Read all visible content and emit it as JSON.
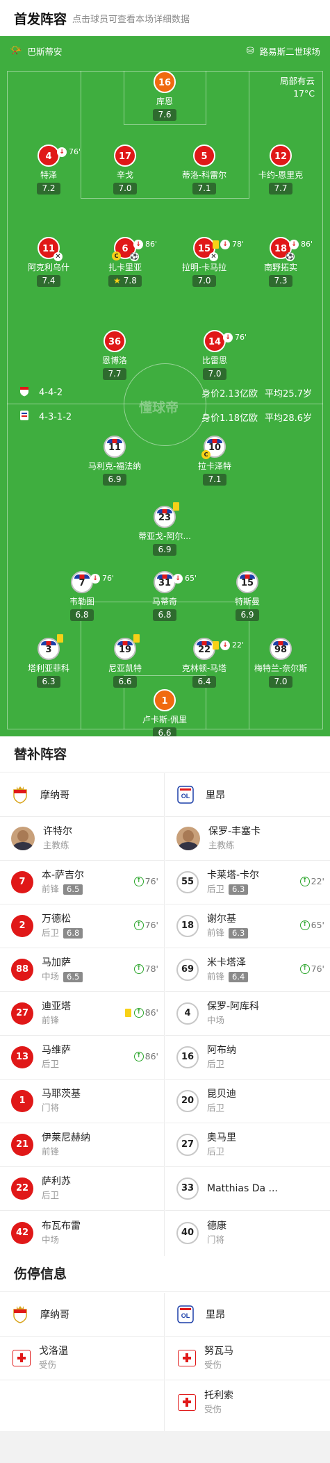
{
  "header": {
    "title": "首发阵容",
    "subtitle": "点击球员可查看本场详细数据"
  },
  "pitch": {
    "home_team": "巴斯蒂安",
    "stadium": "路易斯二世球场",
    "weather": "局部有云",
    "temperature": "17°C",
    "watermark": "懂球帝",
    "home_formation": "4-4-2",
    "home_value": "身价2.13亿欧",
    "home_age": "平均25.7岁",
    "away_formation": "4-3-1-2",
    "away_value": "身价1.18亿欧",
    "away_age": "平均28.6岁"
  },
  "home_players": [
    {
      "num": "16",
      "name": "库恩",
      "score": "7.6"
    },
    {
      "num": "4",
      "name": "特泽",
      "score": "7.2",
      "sub_min": "76'"
    },
    {
      "num": "17",
      "name": "辛戈",
      "score": "7.0"
    },
    {
      "num": "5",
      "name": "蒂洛-科雷尔",
      "score": "7.1"
    },
    {
      "num": "12",
      "name": "卡约-恩里克",
      "score": "7.7"
    },
    {
      "num": "11",
      "name": "阿克利乌什",
      "score": "7.4"
    },
    {
      "num": "6",
      "name": "扎卡里亚",
      "score": "7.8",
      "sub_min": "86'"
    },
    {
      "num": "15",
      "name": "拉明-卡马拉",
      "score": "7.0",
      "sub_min": "78'"
    },
    {
      "num": "18",
      "name": "南野拓实",
      "score": "7.3",
      "sub_min": "86'"
    },
    {
      "num": "36",
      "name": "恩博洛",
      "score": "7.7"
    },
    {
      "num": "14",
      "name": "比雷思",
      "score": "7.0",
      "sub_min": "76'"
    }
  ],
  "away_players": [
    {
      "num": "11",
      "name": "马利克-福法纳",
      "score": "6.9"
    },
    {
      "num": "10",
      "name": "拉卡泽特",
      "score": "7.1"
    },
    {
      "num": "23",
      "name": "蒂亚戈-阿尔...",
      "score": "6.9"
    },
    {
      "num": "7",
      "name": "韦勒图",
      "score": "6.8",
      "sub_min": "76'"
    },
    {
      "num": "31",
      "name": "马蒂奇",
      "score": "6.8",
      "sub_min": "65'"
    },
    {
      "num": "15",
      "name": "特斯曼",
      "score": "6.9"
    },
    {
      "num": "3",
      "name": "塔利亚菲科",
      "score": "6.3"
    },
    {
      "num": "19",
      "name": "尼亚凯特",
      "score": "6.6"
    },
    {
      "num": "22",
      "name": "克林顿-马塔",
      "score": "6.4",
      "sub_min": "22'"
    },
    {
      "num": "98",
      "name": "梅特兰-奈尔斯",
      "score": "7.0"
    },
    {
      "num": "1",
      "name": "卢卡斯-佩里",
      "score": "6.6"
    }
  ],
  "subs": {
    "title": "替补阵容",
    "home_team": "摩纳哥",
    "away_team": "里昂",
    "home_coach": {
      "name": "许特尔",
      "role": "主教练"
    },
    "away_coach": {
      "name": "保罗-丰塞卡",
      "role": "主教练"
    },
    "home": [
      {
        "num": "7",
        "name": "本-萨吉尔",
        "pos": "前锋",
        "score": "6.5",
        "min": "76'"
      },
      {
        "num": "2",
        "name": "万德松",
        "pos": "后卫",
        "score": "6.8",
        "min": "76'"
      },
      {
        "num": "88",
        "name": "马加萨",
        "pos": "中场",
        "score": "6.5",
        "min": "78'"
      },
      {
        "num": "27",
        "name": "迪亚塔",
        "pos": "前锋",
        "min": "86'"
      },
      {
        "num": "13",
        "name": "马维萨",
        "pos": "后卫",
        "min": "86'"
      },
      {
        "num": "1",
        "name": "马耶茨基",
        "pos": "门将"
      },
      {
        "num": "21",
        "name": "伊莱尼赫纳",
        "pos": "前锋"
      },
      {
        "num": "22",
        "name": "萨利苏",
        "pos": "后卫"
      },
      {
        "num": "42",
        "name": "布瓦布雷",
        "pos": "中场"
      }
    ],
    "away": [
      {
        "num": "55",
        "name": "卡莱塔-卡尔",
        "pos": "后卫",
        "score": "6.3",
        "min": "22'"
      },
      {
        "num": "18",
        "name": "谢尔基",
        "pos": "前锋",
        "score": "6.3",
        "min": "65'"
      },
      {
        "num": "69",
        "name": "米卡塔泽",
        "pos": "前锋",
        "score": "6.4",
        "min": "76'"
      },
      {
        "num": "4",
        "name": "保罗-阿库科",
        "pos": "中场"
      },
      {
        "num": "16",
        "name": "阿布纳",
        "pos": "后卫"
      },
      {
        "num": "20",
        "name": "昆贝迪",
        "pos": "后卫"
      },
      {
        "num": "27",
        "name": "奥马里",
        "pos": "后卫"
      },
      {
        "num": "33",
        "name": "Matthias Da ...",
        "pos": ""
      },
      {
        "num": "40",
        "name": "德康",
        "pos": "门将"
      }
    ]
  },
  "injury": {
    "title": "伤停信息",
    "home": [
      {
        "name": "戈洛温",
        "status": "受伤"
      }
    ],
    "away": [
      {
        "name": "努瓦马",
        "status": "受伤"
      },
      {
        "name": "托利索",
        "status": "受伤"
      }
    ]
  }
}
